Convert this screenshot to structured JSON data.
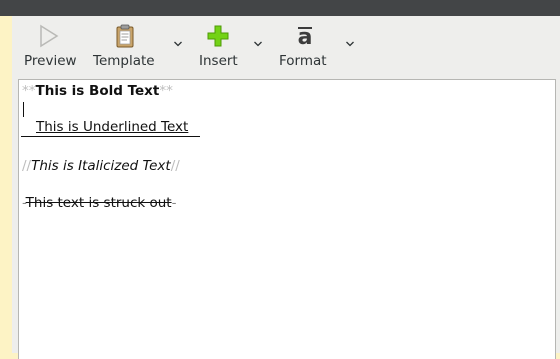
{
  "toolbar": {
    "buttons": [
      {
        "label": "Preview",
        "icon": "preview-icon"
      },
      {
        "label": "Template",
        "icon": "clipboard-icon"
      },
      {
        "label": "Insert",
        "icon": "plus-icon"
      },
      {
        "label": "Format",
        "icon": "format-icon"
      }
    ]
  },
  "editor": {
    "bold_line": {
      "marker_open": "**",
      "text": "This is Bold Text",
      "marker_close": "**"
    },
    "underline_line": {
      "text": "This is Underlined Text"
    },
    "italic_line": {
      "marker_open": "//",
      "text": "This is Italicized Text",
      "marker_close": "//"
    },
    "strike_line": {
      "marker_open": "-",
      "text": "This text is struck out",
      "marker_close": "-"
    }
  },
  "colors": {
    "desktop_background": "#fdf3c5",
    "titlebar": "#434547",
    "toolbar": "#eeeeec",
    "insert_icon_green": "#73d216"
  }
}
